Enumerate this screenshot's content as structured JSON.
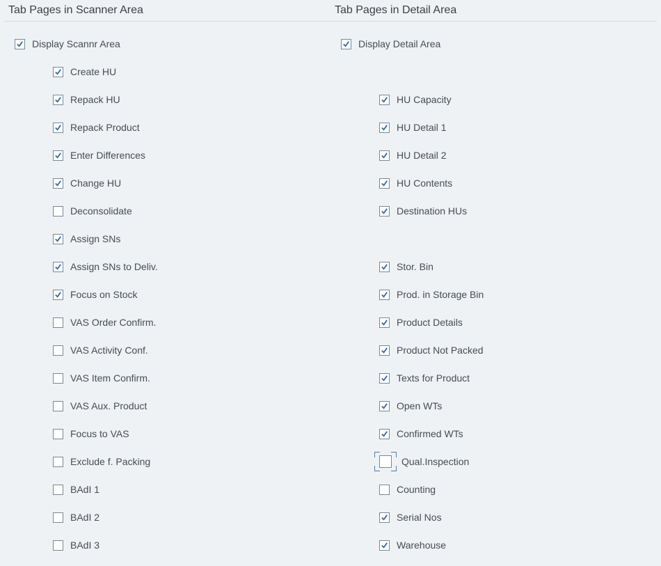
{
  "scanner": {
    "header": "Tab Pages in Scanner Area",
    "root": {
      "label": "Display Scannr Area",
      "checked": true
    },
    "items": [
      {
        "label": "Create HU",
        "checked": true
      },
      {
        "label": "Repack HU",
        "checked": true
      },
      {
        "label": "Repack Product",
        "checked": true
      },
      {
        "label": "Enter Differences",
        "checked": true
      },
      {
        "label": "Change HU",
        "checked": true
      },
      {
        "label": "Deconsolidate",
        "checked": false
      },
      {
        "label": "Assign SNs",
        "checked": true
      },
      {
        "label": "Assign SNs to Deliv.",
        "checked": true
      },
      {
        "label": "Focus on Stock",
        "checked": true
      },
      {
        "label": "VAS Order Confirm.",
        "checked": false
      },
      {
        "label": "VAS Activity Conf.",
        "checked": false
      },
      {
        "label": "VAS Item Confirm.",
        "checked": false
      },
      {
        "label": "VAS Aux. Product",
        "checked": false
      },
      {
        "label": "Focus to VAS",
        "checked": false
      },
      {
        "label": "Exclude f. Packing",
        "checked": false
      },
      {
        "label": "BAdI 1",
        "checked": false
      },
      {
        "label": "BAdI 2",
        "checked": false
      },
      {
        "label": "BAdI 3",
        "checked": false
      }
    ]
  },
  "detail": {
    "header": "Tab Pages in Detail Area",
    "root": {
      "label": "Display Detail Area",
      "checked": true
    },
    "rows": [
      {
        "blank": true
      },
      {
        "label": "HU Capacity",
        "checked": true
      },
      {
        "label": "HU Detail 1",
        "checked": true
      },
      {
        "label": "HU Detail 2",
        "checked": true
      },
      {
        "label": "HU Contents",
        "checked": true
      },
      {
        "label": "Destination HUs",
        "checked": true
      },
      {
        "blank": true
      },
      {
        "label": "Stor. Bin",
        "checked": true
      },
      {
        "label": "Prod. in Storage Bin",
        "checked": true
      },
      {
        "label": "Product Details",
        "checked": true
      },
      {
        "label": "Product Not Packed",
        "checked": true
      },
      {
        "label": "Texts for Product",
        "checked": true
      },
      {
        "label": "Open WTs",
        "checked": true
      },
      {
        "label": "Confirmed WTs",
        "checked": true
      },
      {
        "label": "Qual.Inspection",
        "checked": false,
        "focused": true
      },
      {
        "label": "Counting",
        "checked": false
      },
      {
        "label": "Serial Nos",
        "checked": true
      },
      {
        "label": "Warehouse",
        "checked": true
      }
    ]
  }
}
